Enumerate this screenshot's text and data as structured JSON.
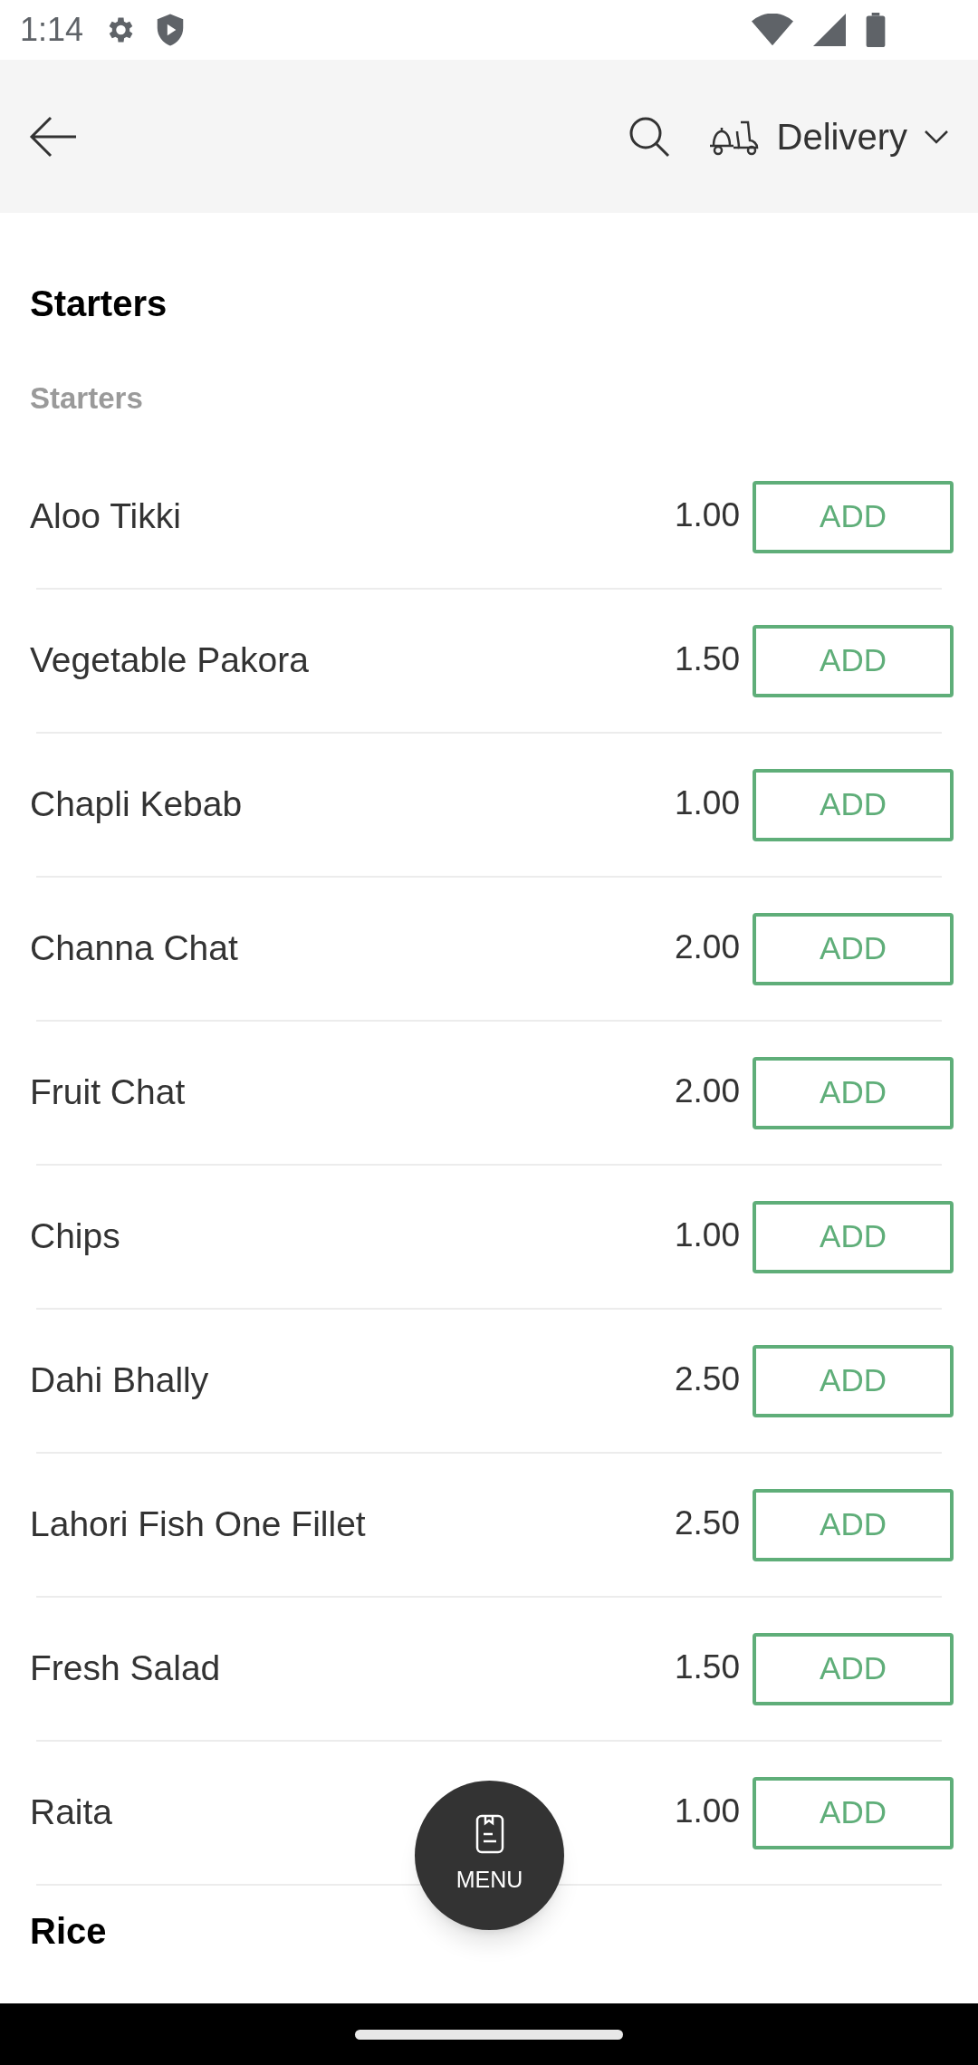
{
  "status_bar": {
    "time": "1:14"
  },
  "header": {
    "mode": "Delivery"
  },
  "section": {
    "title": "Starters",
    "subtitle": "Starters"
  },
  "items": [
    {
      "name": "Aloo Tikki",
      "price": "1.00",
      "action": "ADD"
    },
    {
      "name": "Vegetable Pakora",
      "price": "1.50",
      "action": "ADD"
    },
    {
      "name": "Chapli Kebab",
      "price": "1.00",
      "action": "ADD"
    },
    {
      "name": "Channa Chat",
      "price": "2.00",
      "action": "ADD"
    },
    {
      "name": "Fruit Chat",
      "price": "2.00",
      "action": "ADD"
    },
    {
      "name": "Chips",
      "price": "1.00",
      "action": "ADD"
    },
    {
      "name": "Dahi Bhally",
      "price": "2.50",
      "action": "ADD"
    },
    {
      "name": "Lahori Fish One Fillet",
      "price": "2.50",
      "action": "ADD"
    },
    {
      "name": "Fresh Salad",
      "price": "1.50",
      "action": "ADD"
    },
    {
      "name": "Raita",
      "price": "1.00",
      "action": "ADD"
    }
  ],
  "next_section": {
    "title": "Rice"
  },
  "fab": {
    "label": "MENU"
  }
}
